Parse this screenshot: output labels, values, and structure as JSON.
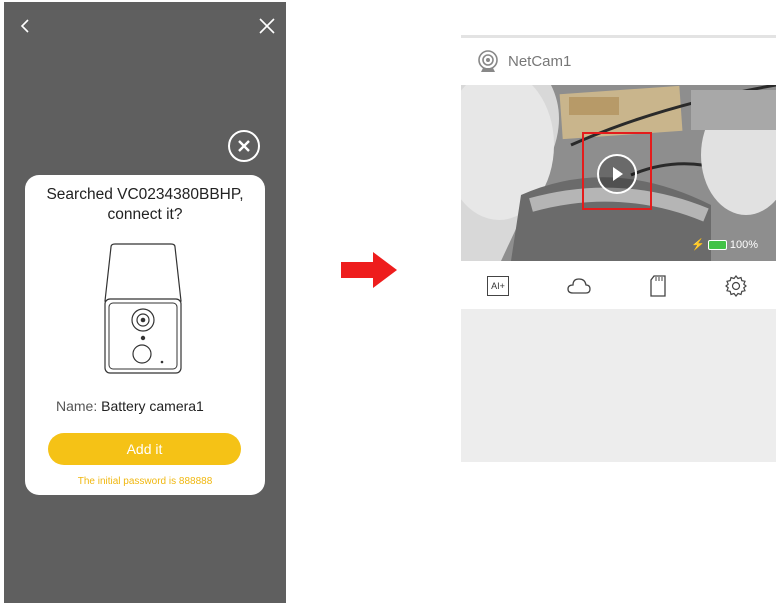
{
  "left_screen": {
    "back_icon": "chevron-left-icon",
    "close_icon": "close-icon",
    "dialog": {
      "close_icon": "close-circle-icon",
      "title_line1": "Searched VC0234380BBHP,",
      "title_line2": "connect it?",
      "illustration": "battery-camera-illustration",
      "name_label": "Name:",
      "name_value": "Battery camera1",
      "add_button": "Add it",
      "password_hint": "The initial password is 888888",
      "accent_color": "#f5c216"
    }
  },
  "arrow_icon": "right-arrow-icon",
  "right_screen": {
    "camera_icon": "webcam-icon",
    "camera_name": "NetCam1",
    "video": {
      "play_icon": "play-icon",
      "battery_icon": "battery-icon",
      "battery_percent": "100%",
      "battery_level": 1.0,
      "highlight_color": "#e41c1c"
    },
    "toolbar": {
      "ai_label": "AI+",
      "cloud_icon": "cloud-icon",
      "sdcard_icon": "sd-card-icon",
      "settings_icon": "gear-icon"
    }
  }
}
